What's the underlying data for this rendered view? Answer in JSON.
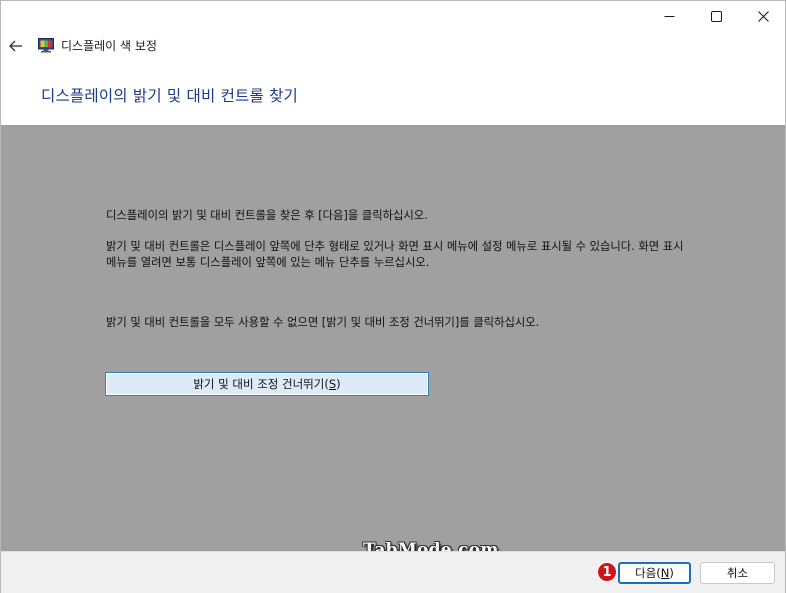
{
  "window": {
    "app_title": "디스플레이 색 보정",
    "heading": "디스플레이의 밝기 및 대비 컨트롤 찾기"
  },
  "content": {
    "paragraph1": "디스플레이의 밝기 및 대비 컨트롤을 찾은 후 [다음]을 클릭하십시오.",
    "paragraph2": "밝기 및 대비 컨트롤은 디스플레이 앞쪽에 단추 형태로 있거나 화면 표시 메뉴에 설정 메뉴로 표시될 수 있습니다. 화면 표시 메뉴를 열려면 보통 디스플레이 앞쪽에 있는 메뉴 단추를 누르십시오.",
    "paragraph3": "밝기 및 대비 컨트롤을 모두 사용할 수 없으면 [밝기 및 대비 조정 건너뛰기]를 클릭하십시오.",
    "skip_button": {
      "label": "밝기 및 대비 조정 건너뛰기",
      "accel": "S"
    }
  },
  "watermark": "TabMode.com",
  "footer": {
    "step_badge": "1",
    "next_button": {
      "label": "다음",
      "accel": "N"
    },
    "cancel_button": {
      "label": "취소"
    }
  },
  "colors": {
    "heading": "#1e3a8a",
    "content_bg": "#a0a0a0",
    "badge": "#d0141a",
    "button_focus": "#1f6fb8"
  }
}
